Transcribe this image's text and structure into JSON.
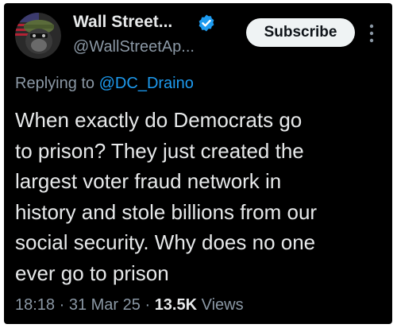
{
  "author": {
    "display_name": "Wall Street...",
    "handle": "@WallStreetAp...",
    "verified_badge_color": "#1d9bf0",
    "avatar_icon": "gorilla-avatar-icon"
  },
  "actions": {
    "subscribe_label": "Subscribe",
    "more_icon": "more-vertical-icon"
  },
  "reply": {
    "prefix": "Replying to ",
    "target": "@DC_Draino"
  },
  "tweet": {
    "lines": [
      "When exactly do Democrats go",
      "to prison? They just created the",
      "largest voter fraud network in",
      "history and stole billions from our",
      "social security. Why does no one",
      "ever go to prison"
    ]
  },
  "meta": {
    "time": "18:18",
    "separator": " · ",
    "date": "31 Mar 25",
    "views_count": "13.5K",
    "views_label": " Views"
  },
  "colors": {
    "background": "#000000",
    "text_primary": "#e7e9ea",
    "text_secondary": "#8b98a5",
    "link": "#1d9bf0",
    "button_bg": "#eff3f4"
  }
}
